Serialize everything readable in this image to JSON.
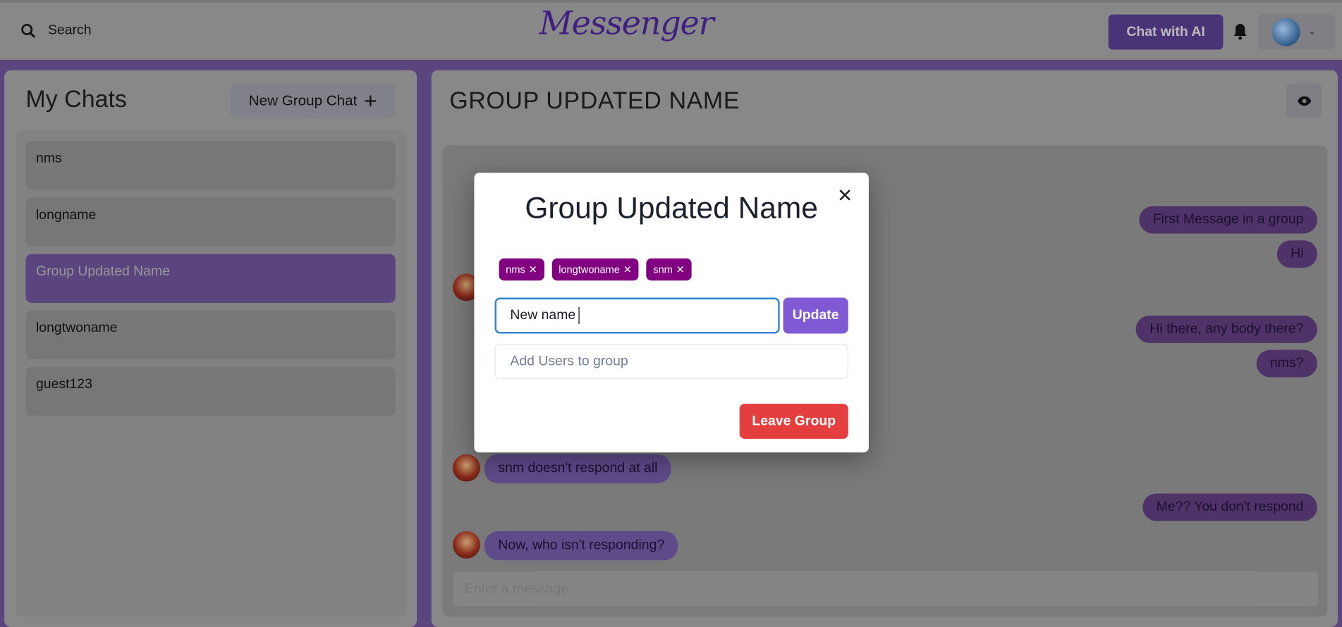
{
  "header": {
    "search_label": "Search",
    "logo": "Messenger",
    "chat_ai_label": "Chat with AI",
    "icons": [
      "search-icon",
      "bell-icon",
      "chevron-down-icon"
    ]
  },
  "sidebar": {
    "title": "My Chats",
    "new_group_label": "New Group Chat",
    "chats": [
      {
        "name": "nms"
      },
      {
        "name": "longname"
      },
      {
        "name": "Group Updated Name",
        "selected": true
      },
      {
        "name": "longtwoname"
      },
      {
        "name": "guest123"
      }
    ]
  },
  "chat": {
    "title": "GROUP UPDATED NAME",
    "input_placeholder": "Enter a message...",
    "messages": [
      {
        "text": "First Message in a group",
        "side": "sent"
      },
      {
        "text": "Hi",
        "side": "sent"
      },
      {
        "text": "Hi there, any body there?",
        "side": "sent"
      },
      {
        "text": "nms?",
        "side": "sent"
      },
      {
        "text": "snm doesn't respond at all",
        "side": "received"
      },
      {
        "text": "Me?? You don't respond",
        "side": "sent"
      },
      {
        "text": "Now, who isn't responding?",
        "side": "received"
      }
    ]
  },
  "modal": {
    "title": "Group Updated Name",
    "members": [
      "nms",
      "longtwoname",
      "snm"
    ],
    "rename_value": "New name",
    "update_label": "Update",
    "add_users_placeholder": "Add Users to group",
    "leave_label": "Leave Group"
  },
  "colors": {
    "brand": "#805ad5",
    "tag": "#800080",
    "danger": "#e53e3e",
    "focus": "#3182ce"
  }
}
